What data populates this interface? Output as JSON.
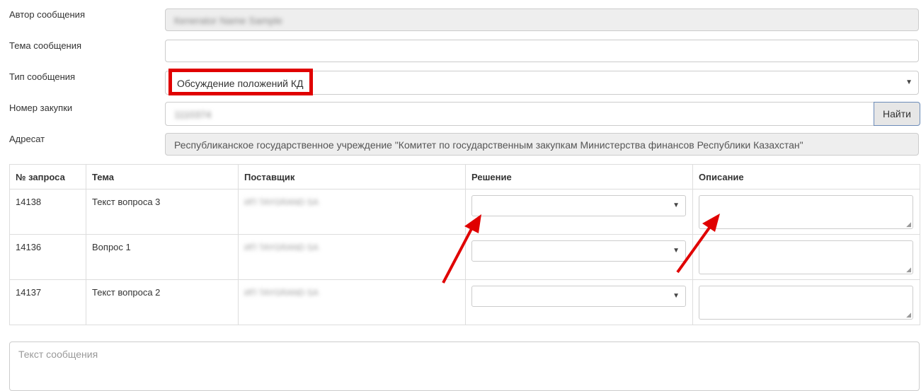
{
  "form": {
    "author": {
      "label": "Автор сообщения",
      "value": "Кenerator Name Sample"
    },
    "subject": {
      "label": "Тема сообщения",
      "value": ""
    },
    "type": {
      "label": "Тип сообщения",
      "value": "Обсуждение положений КД"
    },
    "purchase": {
      "label": "Номер закупки",
      "value": "1110374",
      "button": "Найти"
    },
    "recipient": {
      "label": "Адресат",
      "value": "Республиканское государственное учреждение \"Комитет по государственным закупкам Министерства финансов Республики Казахстан\""
    }
  },
  "table": {
    "headers": [
      "№ запроса",
      "Тема",
      "Поставщик",
      "Решение",
      "Описание"
    ],
    "rows": [
      {
        "id": "14138",
        "topic": "Текст вопроса 3",
        "supplier": "ИП TAYGRAND SA",
        "decision": "",
        "description": ""
      },
      {
        "id": "14136",
        "topic": "Вопрос 1",
        "supplier": "ИП TAYGRAND SA",
        "decision": "",
        "description": ""
      },
      {
        "id": "14137",
        "topic": "Текст вопроса 2",
        "supplier": "ИП TAYGRAND SA",
        "decision": "",
        "description": ""
      }
    ]
  },
  "message": {
    "placeholder": "Текст сообщения"
  },
  "icons": {
    "dropdown": "chevron-down-icon",
    "resize": "resize-grip-icon"
  },
  "colors": {
    "annotation_red": "#e00000",
    "readonly_bg": "#eeeeee",
    "border": "#cccccc"
  }
}
